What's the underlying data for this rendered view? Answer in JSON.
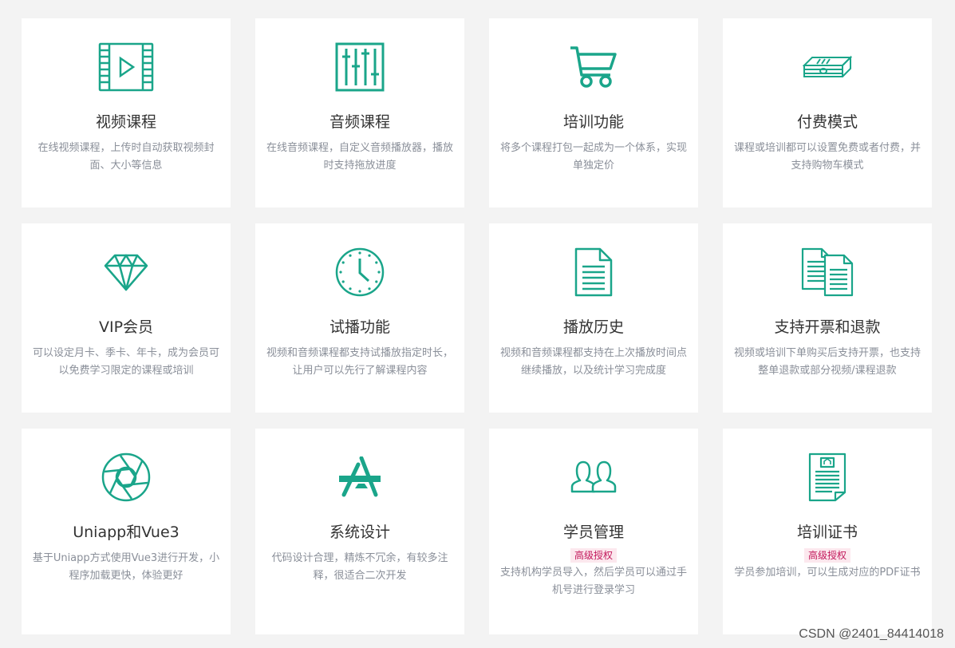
{
  "features": [
    {
      "icon": "video-film-icon",
      "title": "视频课程",
      "desc": "在线视频课程，上传时自动获取视频封面、大小等信息"
    },
    {
      "icon": "equalizer-icon",
      "title": "音频课程",
      "desc": "在线音频课程，自定义音频播放器，播放时支持拖放进度"
    },
    {
      "icon": "shopping-cart-icon",
      "title": "培训功能",
      "desc": "将多个课程打包一起成为一个体系，实现单独定价"
    },
    {
      "icon": "money-stack-icon",
      "title": "付费模式",
      "desc": "课程或培训都可以设置免费或者付费，并支持购物车模式"
    },
    {
      "icon": "diamond-icon",
      "title": "VIP会员",
      "desc": "可以设定月卡、季卡、年卡，成为会员可以免费学习限定的课程或培训"
    },
    {
      "icon": "clock-icon",
      "title": "试播功能",
      "desc": "视频和音频课程都支持试播放指定时长，让用户可以先行了解课程内容"
    },
    {
      "icon": "document-icon",
      "title": "播放历史",
      "desc": "视频和音频课程都支持在上次播放时间点继续播放，以及统计学习完成度"
    },
    {
      "icon": "documents-icon",
      "title": "支持开票和退款",
      "desc": "视频或培训下单购买后支持开票，也支持整单退款或部分视频/课程退款"
    },
    {
      "icon": "aperture-icon",
      "title": "Uniapp和Vue3",
      "desc": "基于Uniapp方式使用Vue3进行开发，小程序加载更快，体验更好"
    },
    {
      "icon": "app-store-icon",
      "title": "系统设计",
      "desc": "代码设计合理，精炼不冗余，有较多注释，很适合二次开发"
    },
    {
      "icon": "users-icon",
      "title": "学员管理",
      "badge": "高级授权",
      "desc": "支持机构学员导入，然后学员可以通过手机号进行登录学习"
    },
    {
      "icon": "certificate-icon",
      "title": "培训证书",
      "badge": "高级授权",
      "desc": "学员参加培训，可以生成对应的PDF证书"
    }
  ],
  "watermark": "CSDN @2401_84414018",
  "colors": {
    "accent": "#1aa58a",
    "badge_bg": "#fce8ee",
    "badge_text": "#c2185b"
  }
}
